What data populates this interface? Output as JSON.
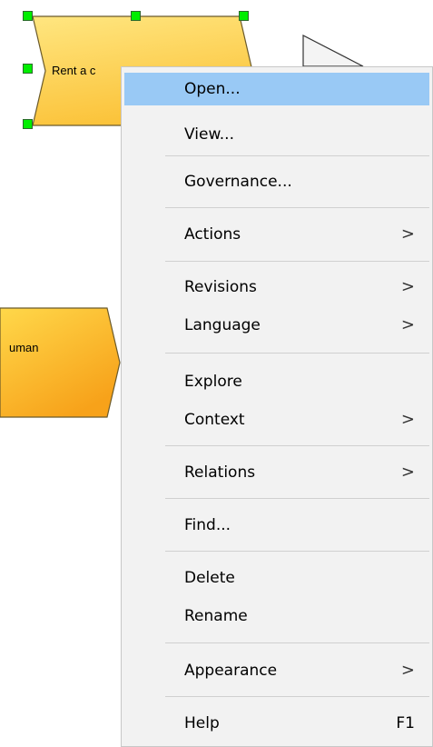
{
  "diagram": {
    "shapes": [
      {
        "label": "Rent a c"
      },
      {
        "label": "uman"
      }
    ],
    "colors": {
      "shape_fill_top": "#ffe680",
      "shape_fill_bottom": "#fbb11b",
      "handle": "#00ee00"
    }
  },
  "context_menu": {
    "highlight_color": "#99c9f5",
    "items": [
      {
        "label": "Open...",
        "highlighted": true
      },
      {
        "label": "View..."
      },
      {
        "label": "Governance..."
      },
      {
        "label": "Actions",
        "submenu": true,
        "arrow": ">"
      },
      {
        "label": "Revisions",
        "submenu": true,
        "arrow": ">"
      },
      {
        "label": "Language",
        "submenu": true,
        "arrow": ">"
      },
      {
        "label": "Explore"
      },
      {
        "label": "Context",
        "submenu": true,
        "arrow": ">"
      },
      {
        "label": "Relations",
        "submenu": true,
        "arrow": ">"
      },
      {
        "label": "Find..."
      },
      {
        "label": "Delete"
      },
      {
        "label": "Rename"
      },
      {
        "label": "Appearance",
        "submenu": true,
        "arrow": ">"
      },
      {
        "label": "Help",
        "shortcut": "F1"
      }
    ]
  }
}
